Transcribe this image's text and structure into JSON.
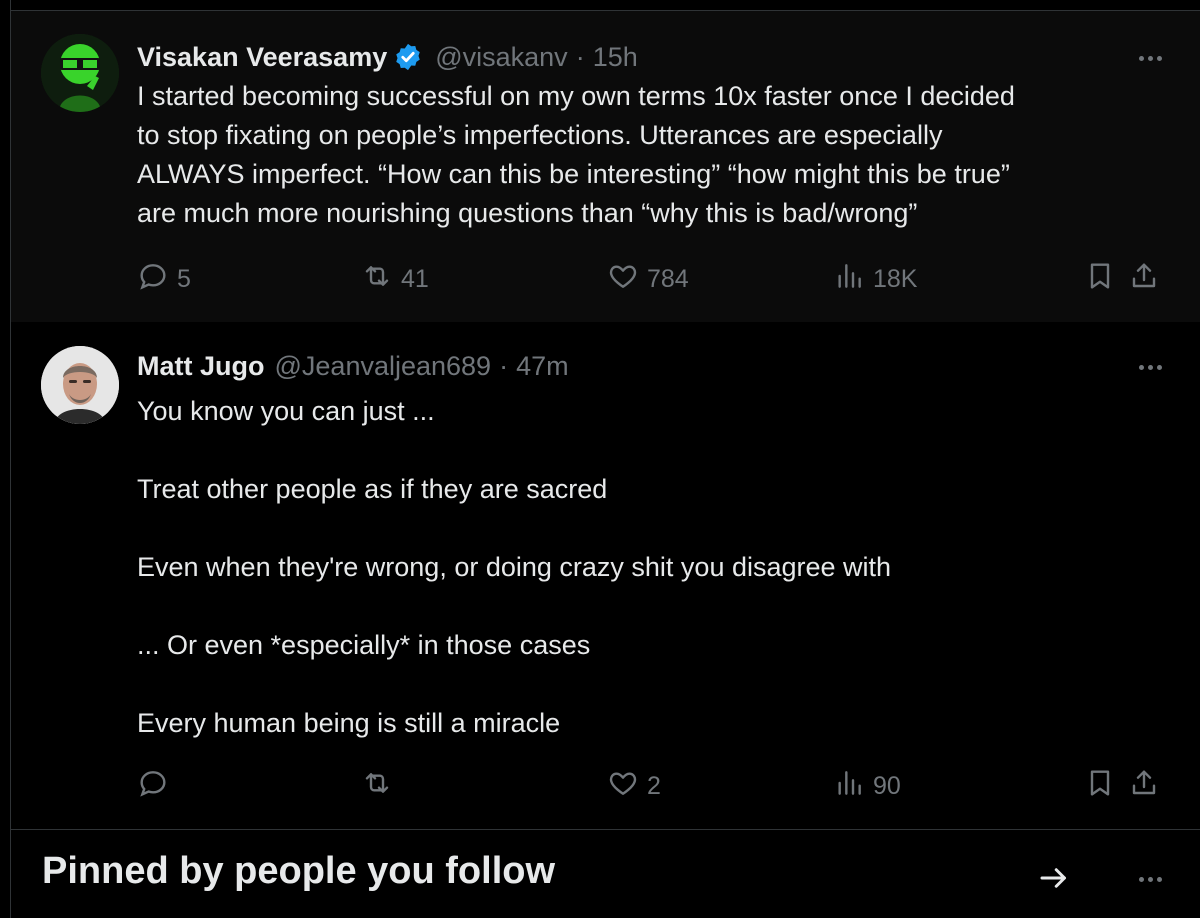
{
  "tweets": [
    {
      "author_name": "Visakan Veerasamy",
      "verified": true,
      "handle": "@visakanv",
      "separator": "·",
      "time": "15h",
      "text_lines": [
        "I started becoming successful on my own terms 10x faster once I decided",
        "to stop fixating on people’s imperfections. Utterances are especially",
        "ALWAYS imperfect. “How can this be interesting” “how might this be true”",
        "are much more nourishing questions than “why this is bad/wrong”"
      ],
      "replies": "5",
      "reposts": "41",
      "likes": "784",
      "views": "18K"
    },
    {
      "author_name": "Matt Jugo",
      "verified": false,
      "handle": "@Jeanvaljean689",
      "separator": "·",
      "time": "47m",
      "paragraphs": [
        "You know you can just ...",
        "Treat other people as if they are sacred",
        "Even when they're wrong, or doing crazy shit you disagree with",
        "... Or even *especially* in those cases",
        "Every human being is still a miracle"
      ],
      "replies": "",
      "reposts": "",
      "likes": "2",
      "views": "90"
    }
  ],
  "pinned_section": {
    "title": "Pinned by people you follow"
  },
  "icons": {
    "reply": "reply-icon",
    "repost": "repost-icon",
    "like": "heart-icon",
    "views": "views-icon",
    "bookmark": "bookmark-icon",
    "share": "share-icon",
    "more": "more-icon",
    "verified": "verified-badge-icon",
    "arrow": "arrow-right-icon"
  },
  "colors": {
    "background": "#000000",
    "text_primary": "#e7e9ea",
    "text_secondary": "#71767b",
    "verified_blue": "#1d9bf0",
    "border": "#2f3336"
  }
}
